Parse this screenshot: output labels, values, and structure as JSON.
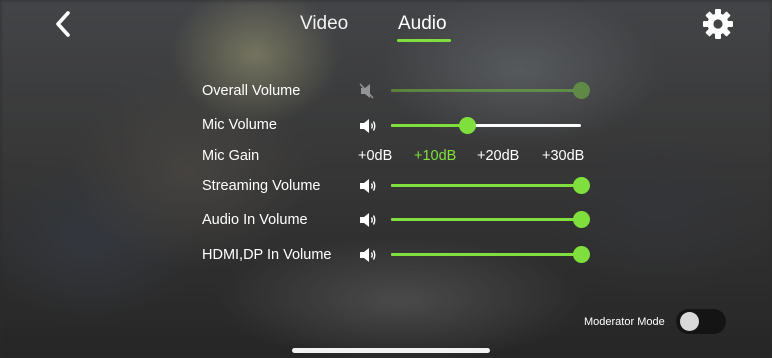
{
  "header": {
    "tabs": [
      {
        "label": "Video",
        "selected": false
      },
      {
        "label": "Audio",
        "selected": true
      }
    ],
    "back_icon": "chevron-left-icon",
    "settings_icon": "gear-icon"
  },
  "controls": {
    "overall_volume": {
      "label": "Overall Volume",
      "icon": "speaker-muted-icon",
      "level_percent": 100,
      "enabled": false
    },
    "mic_volume": {
      "label": "Mic Volume",
      "icon": "speaker-icon",
      "level_percent": 40,
      "enabled": true
    },
    "mic_gain": {
      "label": "Mic Gain",
      "options": [
        "+0dB",
        "+10dB",
        "+20dB",
        "+30dB"
      ],
      "selected": "+10dB"
    },
    "streaming_volume": {
      "label": "Streaming Volume",
      "icon": "speaker-icon",
      "level_percent": 100,
      "enabled": true
    },
    "audio_in_volume": {
      "label": "Audio In Volume",
      "icon": "speaker-icon",
      "level_percent": 100,
      "enabled": true
    },
    "hdmi_dp_in_volume": {
      "label": "HDMI,DP In Volume",
      "icon": "speaker-icon",
      "level_percent": 100,
      "enabled": true
    }
  },
  "footer": {
    "moderator_mode_label": "Moderator Mode",
    "moderator_mode_on": false
  },
  "colors": {
    "accent": "#7fe03d",
    "track": "#ffffff",
    "toggle_off": "#141414"
  }
}
